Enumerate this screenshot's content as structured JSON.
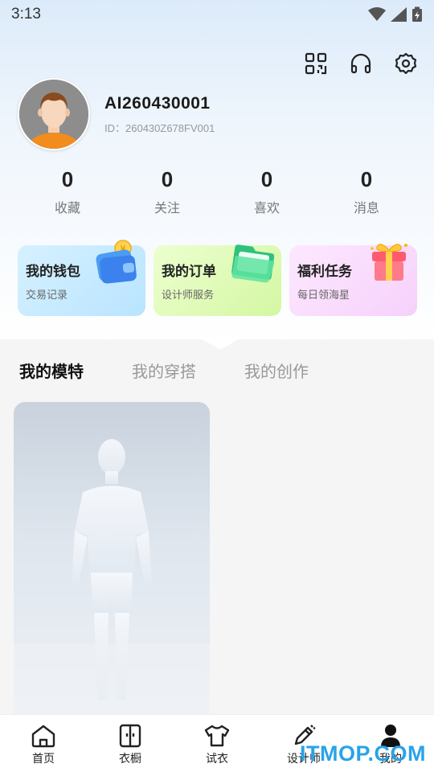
{
  "status_bar": {
    "time": "3:13",
    "wifi_icon": "wifi-icon",
    "signal_icon": "signal-icon",
    "battery_icon": "battery-charging-icon"
  },
  "header_actions": [
    {
      "icon": "qr-code-icon"
    },
    {
      "icon": "headset-icon"
    },
    {
      "icon": "settings-gear-icon"
    }
  ],
  "profile": {
    "username": "AI260430001",
    "user_id": "ID：260430Z678FV001"
  },
  "stats": [
    {
      "value": "0",
      "label": "收藏"
    },
    {
      "value": "0",
      "label": "关注"
    },
    {
      "value": "0",
      "label": "喜欢"
    },
    {
      "value": "0",
      "label": "消息"
    }
  ],
  "cards": [
    {
      "title": "我的钱包",
      "subtitle": "交易记录",
      "icon": "wallet-icon"
    },
    {
      "title": "我的订单",
      "subtitle": "设计师服务",
      "icon": "folder-icon"
    },
    {
      "title": "福利任务",
      "subtitle": "每日领海星",
      "icon": "gift-box-icon"
    }
  ],
  "tabs": [
    {
      "label": "我的模特",
      "active": true
    },
    {
      "label": "我的穿搭",
      "active": false
    },
    {
      "label": "我的创作",
      "active": false
    }
  ],
  "bottom_nav": [
    {
      "label": "首页",
      "icon": "home-icon"
    },
    {
      "label": "衣橱",
      "icon": "wardrobe-icon"
    },
    {
      "label": "试衣",
      "icon": "tshirt-icon"
    },
    {
      "label": "设计师",
      "icon": "pencil-icon"
    },
    {
      "label": "我的",
      "icon": "person-icon"
    }
  ],
  "watermark": "ITMOP.COM",
  "colors": {
    "accent_blue": "#2aa3e8",
    "wallet_bg": "#c6eaff",
    "order_bg": "#dcf9b5",
    "task_bg": "#f8dcfc"
  }
}
